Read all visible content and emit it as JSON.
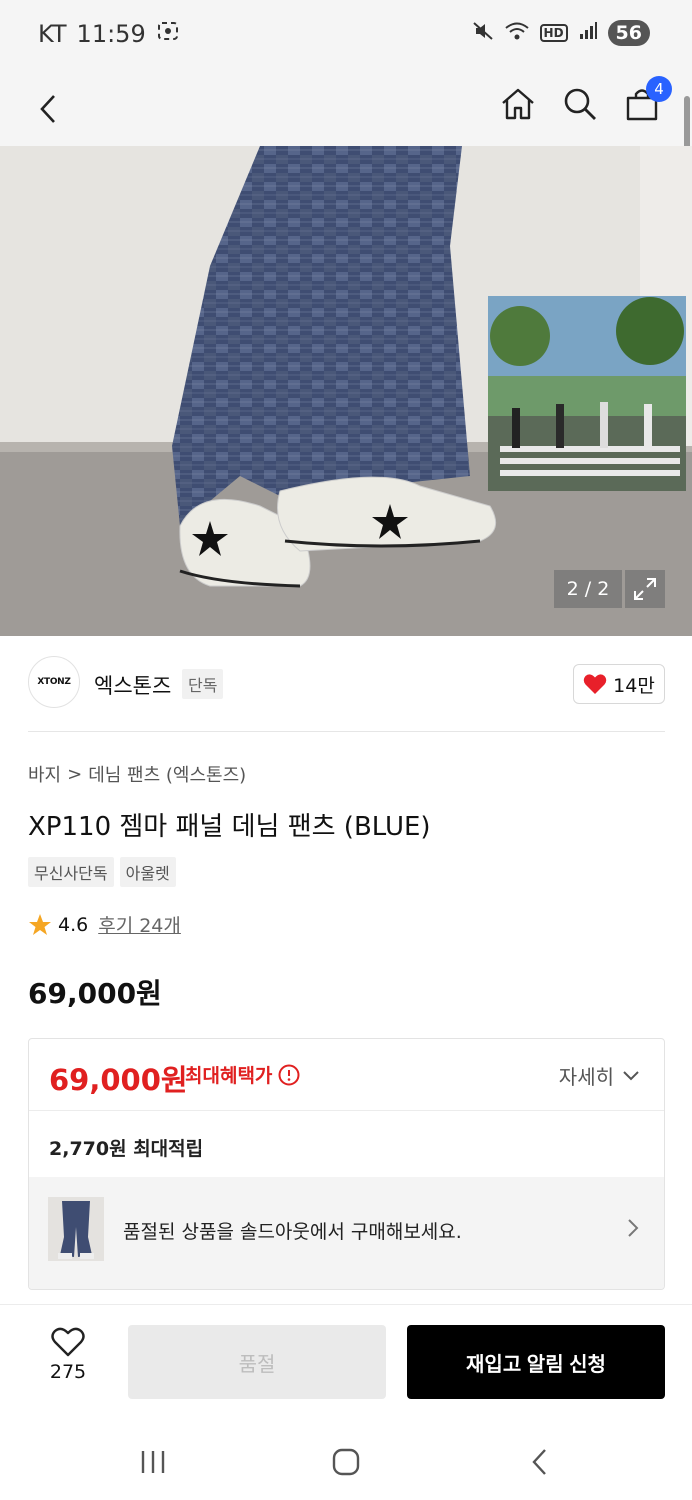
{
  "status_bar": {
    "carrier": "KT",
    "time": "11:59",
    "battery": "56",
    "hd_label": "HD"
  },
  "nav": {
    "cart_count": "4"
  },
  "gallery": {
    "counter": "2 / 2"
  },
  "brand": {
    "logo_text": "XTONZ",
    "name": "엑스톤즈",
    "badge": "단독",
    "likes": "14만"
  },
  "breadcrumb": {
    "category": "바지",
    "sub": "데님 팬츠 (엑스톤즈)",
    "separator": ">"
  },
  "product": {
    "title": "XP110 젬마 패널 데님 팬츠 (BLUE)",
    "tags": [
      "무신사단독",
      "아울렛"
    ],
    "rating": "4.6",
    "reviews": "후기 24개",
    "price": "69,000원"
  },
  "benefit": {
    "max_price": "69,000원",
    "max_label": "최대혜택가",
    "detail_label": "자세히",
    "points": "2,770원 최대적립",
    "soldout_banner": "품절된 상품을 솔드아웃에서 구매해보세요."
  },
  "actions": {
    "wish_count": "275",
    "soldout_label": "품절",
    "restock_label": "재입고 알림 신청"
  },
  "colors": {
    "accent_red": "#e02020",
    "badge_blue": "#2962ff",
    "heart_red": "#e8202a"
  }
}
